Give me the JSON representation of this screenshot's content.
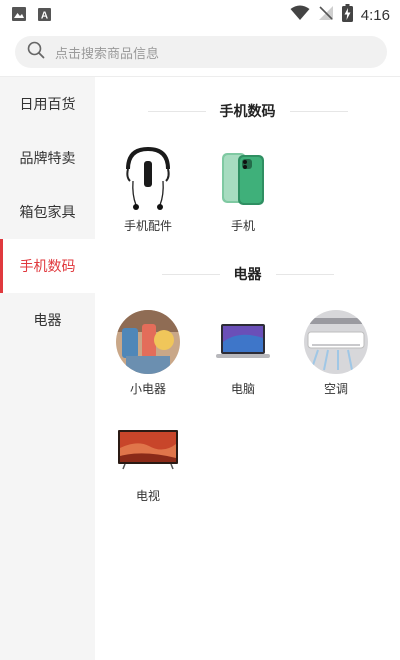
{
  "status_bar": {
    "time": "4:16"
  },
  "search": {
    "placeholder": "点击搜索商品信息"
  },
  "sidebar": {
    "items": [
      {
        "label": "日用百货"
      },
      {
        "label": "品牌特卖"
      },
      {
        "label": "箱包家具"
      },
      {
        "label": "手机数码"
      },
      {
        "label": "电器"
      }
    ]
  },
  "sections": [
    {
      "title": "手机数码",
      "items": [
        {
          "label": "手机配件",
          "icon": "earphone-image-icon"
        },
        {
          "label": "手机",
          "icon": "phone-image-icon"
        }
      ]
    },
    {
      "title": "电器",
      "items": [
        {
          "label": "小电器",
          "icon": "small-appliance-image-icon"
        },
        {
          "label": "电脑",
          "icon": "laptop-image-icon"
        },
        {
          "label": "空调",
          "icon": "air-conditioner-image-icon"
        },
        {
          "label": "电视",
          "icon": "tv-image-icon"
        }
      ]
    }
  ],
  "colors": {
    "accent": "#e0393e",
    "sidebar_bg": "#f5f5f5",
    "search_bg": "#f1f1f1"
  }
}
